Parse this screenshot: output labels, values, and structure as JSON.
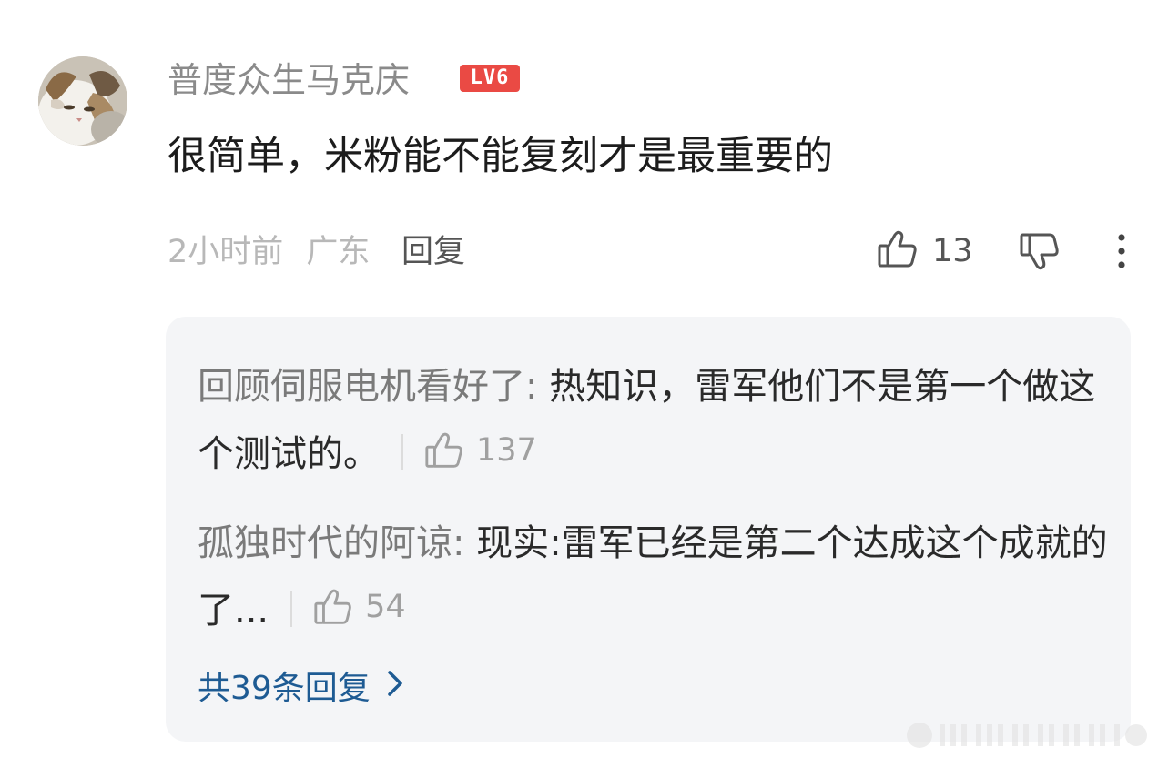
{
  "comment": {
    "username": "普度众生马克庆",
    "level_badge": "LV6",
    "text": "很简单，米粉能不能复刻才是最重要的",
    "time": "2小时前",
    "location": "广东",
    "reply_label": "回复",
    "like_count": "13"
  },
  "replies": [
    {
      "author": "回顾伺服电机看好了",
      "colon": ": ",
      "text": "热知识，雷军他们不是第一个做这个测试的。",
      "likes": "137"
    },
    {
      "author": "孤独时代的阿谅",
      "colon": ": ",
      "text": "现实:雷军已经是第二个达成这个成就的了...",
      "likes": "54"
    }
  ],
  "more_replies_label": "共39条回复",
  "colors": {
    "badge": "#ea4a44",
    "link": "#1e5b93",
    "reply_box_bg": "#f4f5f7"
  },
  "icons": [
    "avatar-cat",
    "thumbs-up-icon",
    "thumbs-down-icon",
    "more-vertical-icon",
    "chevron-right-icon"
  ]
}
